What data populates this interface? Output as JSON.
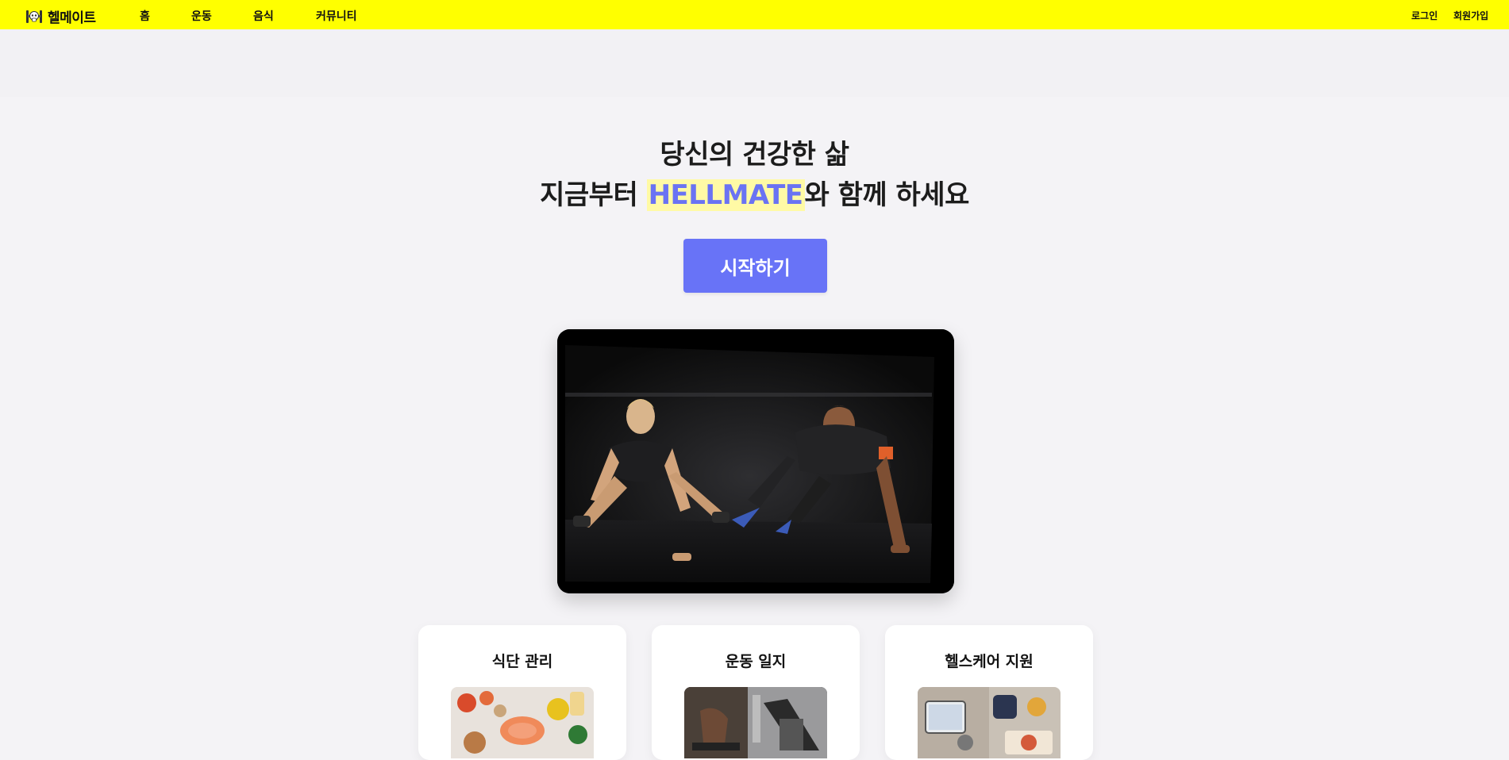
{
  "nav": {
    "brand": "헬메이트",
    "brand_icon": "skull-barbell-icon",
    "links": [
      "홈",
      "운동",
      "음식",
      "커뮤니티"
    ],
    "login": "로그인",
    "signup": "회원가입"
  },
  "hero": {
    "line1": "당신의 건강한 삶",
    "line2_prefix": "지금부터 ",
    "line2_brand": "HELLMATE",
    "line2_suffix": "와 함께 하세요",
    "cta_label": "시작하기"
  },
  "features": [
    {
      "title": "식단 관리",
      "image": "healthy-food-photo"
    },
    {
      "title": "운동 일지",
      "image": "gym-workout-photo"
    },
    {
      "title": "헬스케어 지원",
      "image": "healthcare-devices-photo"
    }
  ],
  "colors": {
    "nav_bg": "#ffff00",
    "accent": "#6873f7",
    "highlight_bg": "#fffaa5",
    "page_bg": "#f4f3f6"
  }
}
